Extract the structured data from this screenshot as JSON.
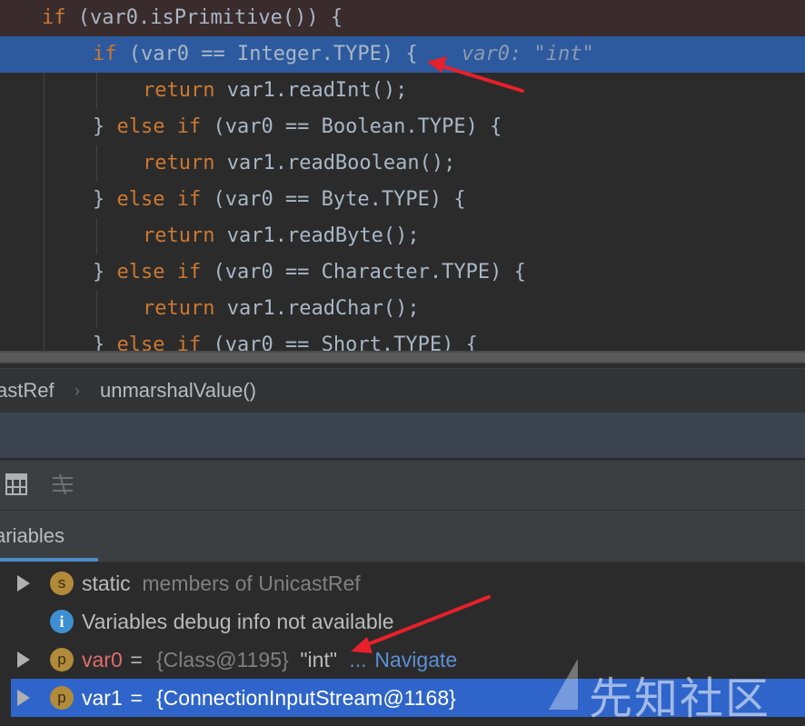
{
  "editor": {
    "lines": [
      {
        "pre": "if",
        "rest": " (var0.isPrimitive()) {"
      },
      {
        "pre": "if",
        "rest": " (var0 == Integer.TYPE) {",
        "hint": "var0: \"int\""
      },
      {
        "pre": "return",
        "rest": " var1.readInt();"
      },
      {
        "pre": "} ",
        "kw": "else if",
        "rest": " (var0 == Boolean.TYPE) {"
      },
      {
        "pre": "return",
        "rest": " var1.readBoolean();"
      },
      {
        "pre": "} ",
        "kw": "else if",
        "rest": " (var0 == Byte.TYPE) {"
      },
      {
        "pre": "return",
        "rest": " var1.readByte();"
      },
      {
        "pre": "} ",
        "kw": "else if",
        "rest": " (var0 == Character.TYPE) {"
      },
      {
        "pre": "return",
        "rest": " var1.readChar();"
      },
      {
        "pre": "} ",
        "kw": "else if",
        "rest": " (var0 == Short.TYPE) {"
      }
    ]
  },
  "breadcrumb": {
    "class": "astRef",
    "separator": "›",
    "method": "unmarshalValue()"
  },
  "debug": {
    "toolbar_icons": [
      "table-icon",
      "settings-list-icon"
    ],
    "variables_tab": "ariables",
    "rows": [
      {
        "badge": "s",
        "name": "static",
        "value": " members of UnicastRef"
      },
      {
        "info": "i",
        "text": "Variables debug info not available"
      },
      {
        "badge": "p",
        "name": "var0",
        "eq": " = ",
        "type": "{Class@1195}",
        "val": " \"int\"",
        "ellipsis": " ...",
        "link": " Navigate"
      },
      {
        "badge": "p",
        "name": "var1",
        "eq": " = ",
        "type": "{ConnectionInputStream@1168}"
      }
    ]
  },
  "watermark": "先知社区",
  "colors": {
    "keyword": "#cc7832",
    "highlight": "#2d5a9e",
    "selection": "#2f65ca",
    "arrow": "#e8202a"
  }
}
